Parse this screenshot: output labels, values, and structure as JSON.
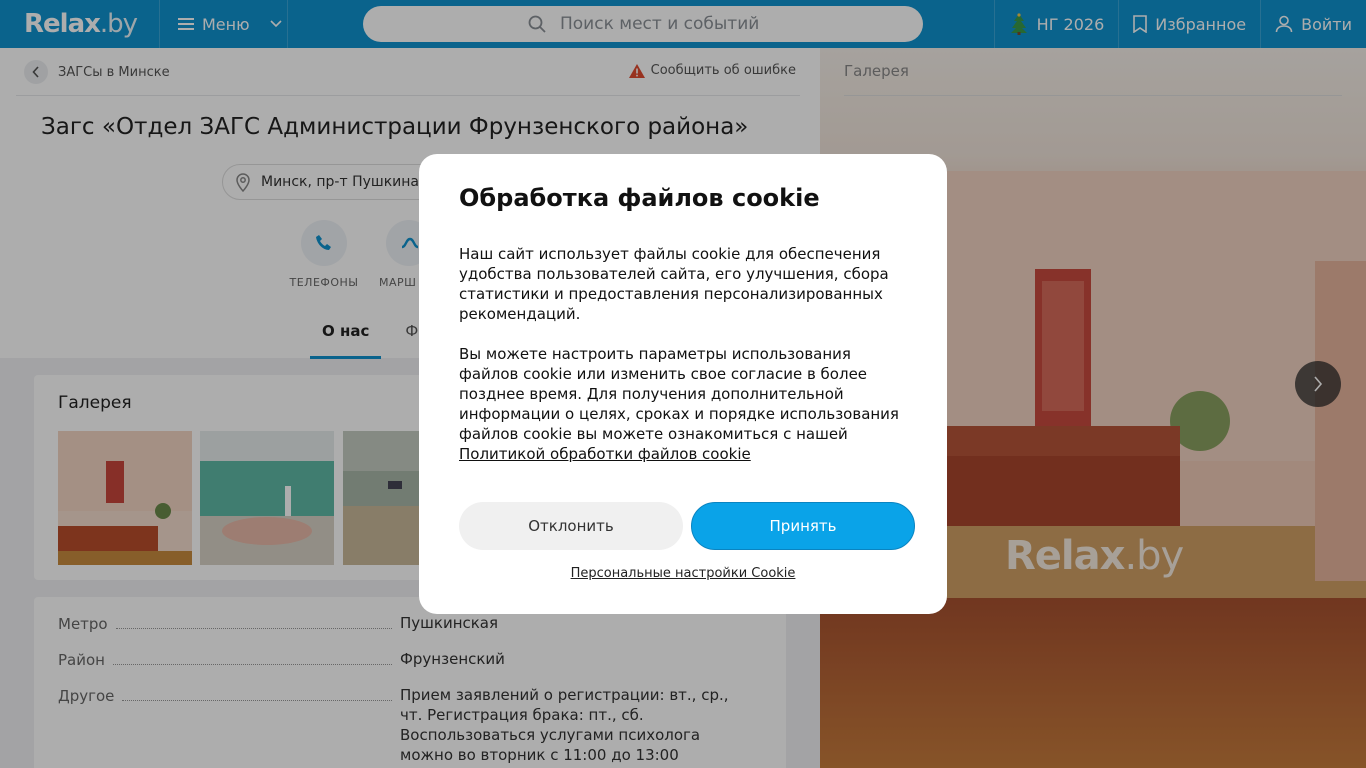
{
  "header": {
    "logo_main": "Relax",
    "logo_suffix": ".by",
    "menu_label": "Меню",
    "search_placeholder": "Поиск мест и событий",
    "ng_label": "НГ 2026",
    "favorites_label": "Избранное",
    "login_label": "Войти"
  },
  "page": {
    "breadcrumb": "ЗАГСы в Минске",
    "report_error": "Сообщить об ошибке",
    "title": "Загс «Отдел ЗАГС Администрации Фрунзенского района»",
    "address": "Минск, пр-т Пушкина",
    "actions": [
      {
        "label": "ТЕЛЕФОНЫ"
      },
      {
        "label": "МАРШ"
      }
    ],
    "tabs": [
      {
        "label": "О нас"
      },
      {
        "label": "Фот"
      }
    ]
  },
  "gallery": {
    "title": "Галерея"
  },
  "info": {
    "rows": [
      {
        "label": "Метро",
        "value": "Пушкинская"
      },
      {
        "label": "Район",
        "value": "Фрунзенский"
      },
      {
        "label": "Другое",
        "value": "Прием заявлений о регистрации: вт., ср., чт. Регистрация брака: пт., сб. Воспользоваться услугами психолога можно во вторник с 11:00 до 13:00"
      }
    ]
  },
  "right_panel": {
    "title": "Галерея",
    "watermark_main": "Relax",
    "watermark_suffix": ".by"
  },
  "cookie_modal": {
    "title": "Обработка файлов cookie",
    "paragraph1": "Наш сайт использует файлы cookie для обеспечения удобства пользователей сайта, его улучшения, сбора статистики и предоставления персонализированных рекомендаций.",
    "paragraph2": "Вы можете настроить параметры использования файлов cookie или изменить свое согласие в более позднее время. Для получения дополнительной информации о целях, сроках и порядке использования файлов cookie вы можете ознакомиться с нашей",
    "policy_link": "Политикой обработки файлов cookie",
    "decline_label": "Отклонить",
    "accept_label": "Принять",
    "settings_label": "Персональные настройки Cookie"
  },
  "colors": {
    "brand": "#0f93cf",
    "accept": "#0aa3e8",
    "warning": "#e04a2f"
  }
}
